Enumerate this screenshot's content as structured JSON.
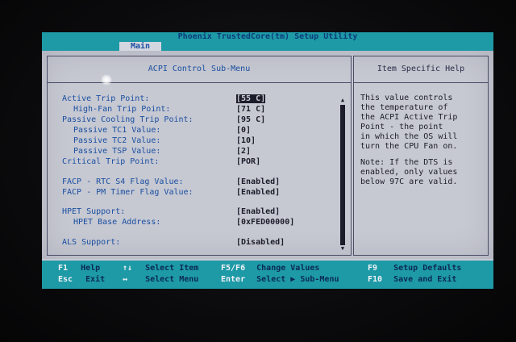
{
  "window": {
    "title": "Phoenix TrustedCore(tm) Setup Utility",
    "active_tab": "Main"
  },
  "left_panel": {
    "header": "ACPI Control Sub-Menu",
    "settings": [
      {
        "label": "Active Trip Point:",
        "value": "[55 C]",
        "indent": 0
      },
      {
        "label": "High-Fan Trip Point:",
        "value": "[71 C]",
        "indent": 1
      },
      {
        "label": "Passive Cooling Trip Point:",
        "value": "[95 C]",
        "indent": 0
      },
      {
        "label": "Passive TC1 Value:",
        "value": "[0]",
        "indent": 1
      },
      {
        "label": "Passive TC2 Value:",
        "value": "[10]",
        "indent": 1
      },
      {
        "label": "Passive TSP Value:",
        "value": "[2]",
        "indent": 1
      },
      {
        "label": "Critical Trip Point:",
        "value": "[POR]",
        "indent": 0
      },
      {
        "label": "FACP - RTC S4 Flag Value:",
        "value": "[Enabled]",
        "indent": 0
      },
      {
        "label": "FACP - PM Timer Flag Value:",
        "value": "[Enabled]",
        "indent": 0
      },
      {
        "label": "HPET Support:",
        "value": "[Enabled]",
        "indent": 0
      },
      {
        "label": "HPET Base Address:",
        "value": "[0xFED00000]",
        "indent": 1
      },
      {
        "label": "ALS Support:",
        "value": "[Disabled]",
        "indent": 0
      }
    ]
  },
  "right_panel": {
    "header": "Item Specific Help",
    "help_para1": "This value controls\nthe temperature of\nthe ACPI Active Trip\nPoint - the point\nin which the OS will\nturn the CPU Fan on.",
    "help_para2": "Note: If the DTS is\nenabled, only values\nbelow 97C are valid."
  },
  "footer": {
    "row1": [
      {
        "key": "F1",
        "desc": "Help"
      },
      {
        "key": "↑↓",
        "desc": "Select Item"
      },
      {
        "key": "F5/F6",
        "desc": "Change Values"
      },
      {
        "key": "F9",
        "desc": "Setup Defaults"
      }
    ],
    "row2": [
      {
        "key": "Esc",
        "desc": "Exit"
      },
      {
        "key": "↔",
        "desc": "Select Menu"
      },
      {
        "key": "Enter",
        "desc": "Select ▶ Sub-Menu"
      },
      {
        "key": "F10",
        "desc": "Save and Exit"
      }
    ]
  },
  "colors": {
    "screen_bg": "#c6c8d2",
    "bar_cyan": "#1e9aa6",
    "label_blue": "#1a4fa0",
    "value_dark": "#1c1d2a"
  }
}
